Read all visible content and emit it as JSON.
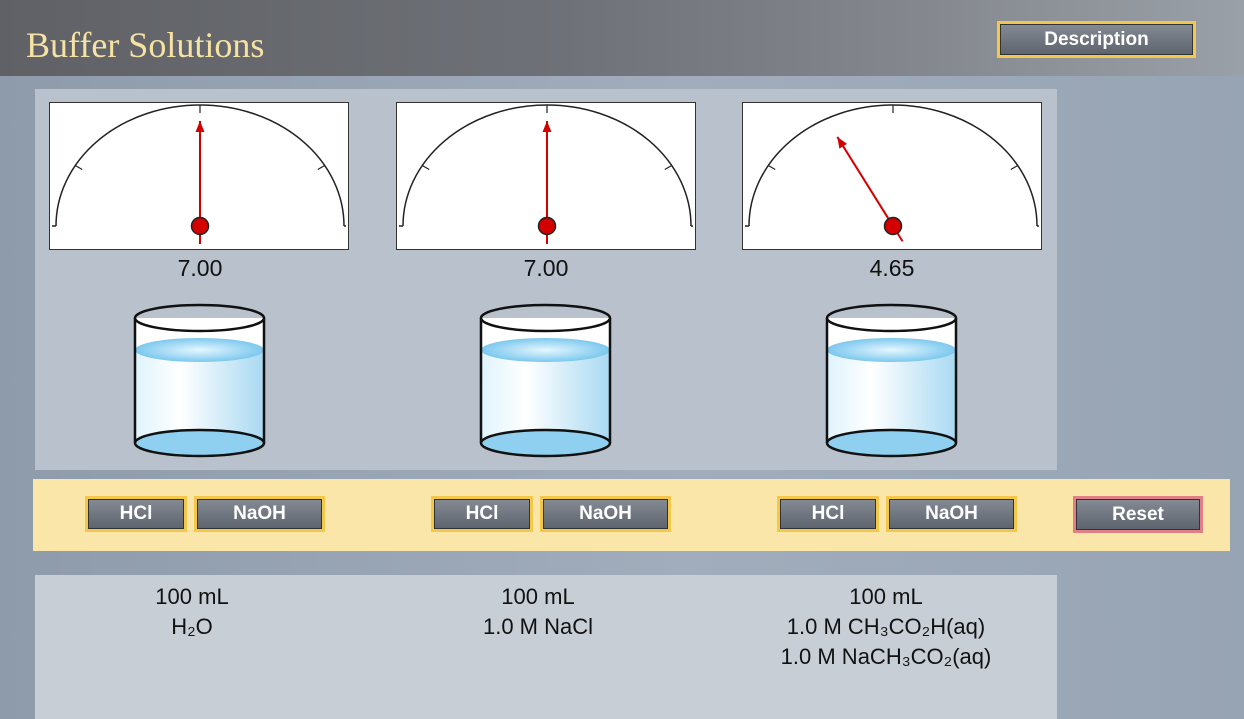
{
  "app": {
    "title": "Buffer Solutions",
    "description_button": "Description"
  },
  "colors": {
    "title_text": "#f6e3a4",
    "button_border": "#f3c84a",
    "reset_border": "#e07f84",
    "needle": "#d40000",
    "control_bar": "#fae6a8",
    "solution": "#bfe6f7"
  },
  "beakers": [
    {
      "ph": "7.00",
      "needle_angle_deg": 0,
      "volume": "100 mL",
      "solution": [
        "H₂O"
      ],
      "buttons": {
        "acid": "HCl",
        "base": "NaOH"
      }
    },
    {
      "ph": "7.00",
      "needle_angle_deg": 0,
      "volume": "100 mL",
      "solution": [
        "1.0 M NaCl"
      ],
      "buttons": {
        "acid": "HCl",
        "base": "NaOH"
      }
    },
    {
      "ph": "4.65",
      "needle_angle_deg": -32,
      "volume": "100 mL",
      "solution": [
        "1.0 M CH₃CO₂H(aq)",
        "1.0 M NaCH₃CO₂(aq)"
      ],
      "buttons": {
        "acid": "HCl",
        "base": "NaOH"
      }
    }
  ],
  "controls": {
    "reset_label": "Reset"
  }
}
